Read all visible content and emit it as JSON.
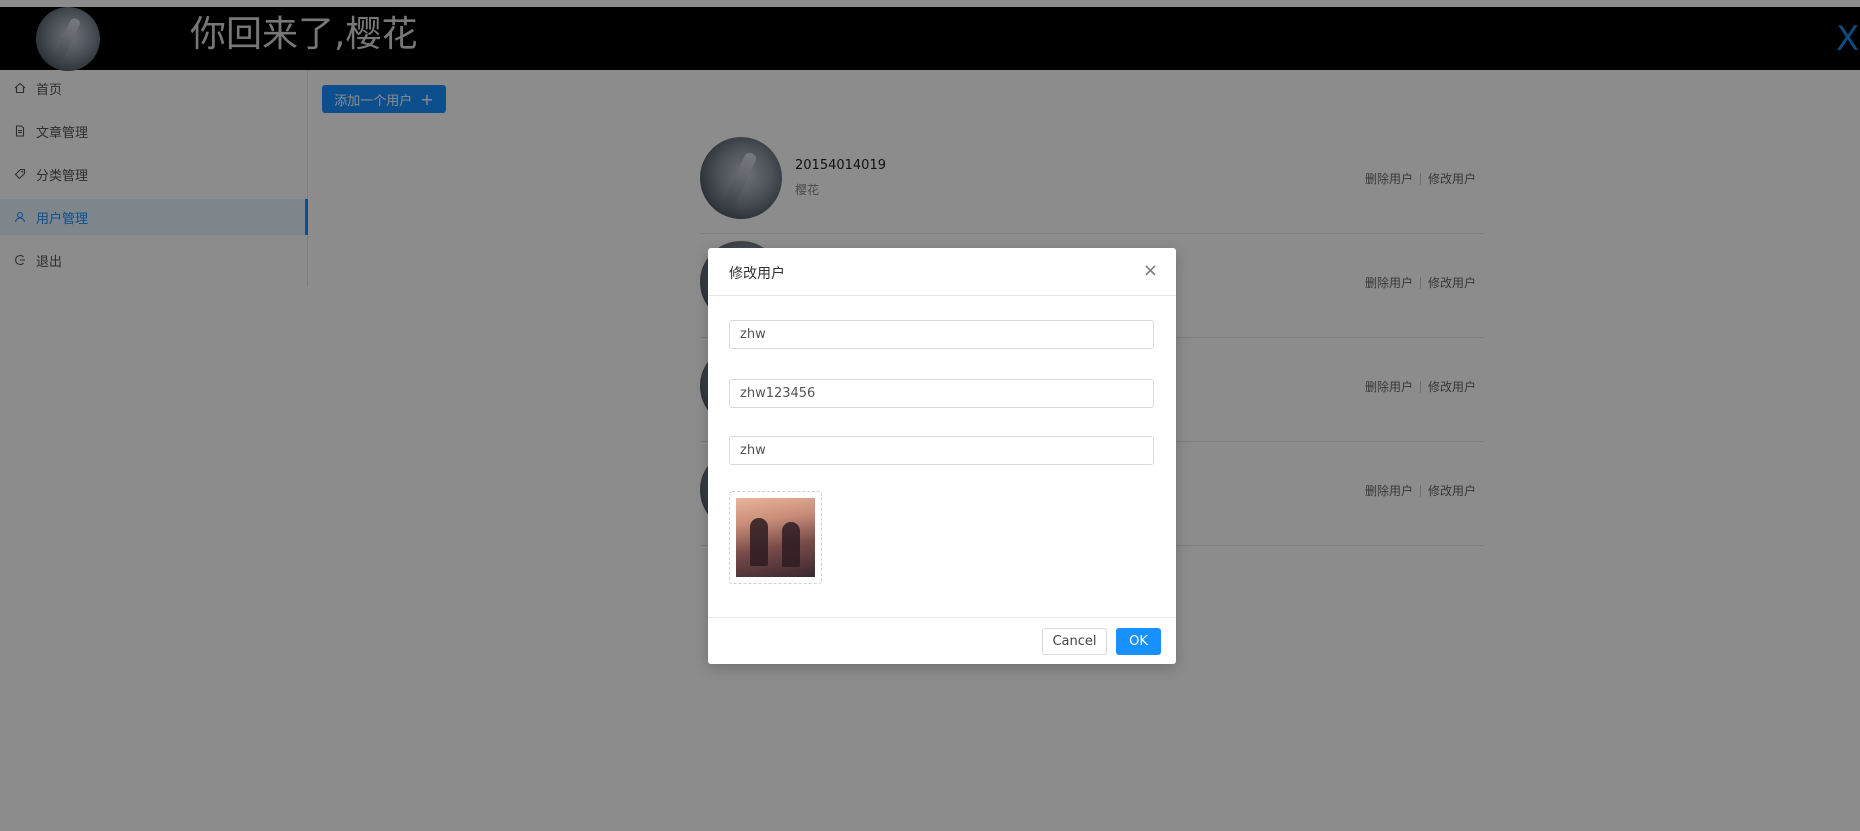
{
  "header": {
    "title": "你回来了,樱花",
    "close_glyph": "X"
  },
  "sidebar": {
    "items": [
      {
        "label": "首页",
        "icon": "home-icon"
      },
      {
        "label": "文章管理",
        "icon": "file-icon"
      },
      {
        "label": "分类管理",
        "icon": "tag-icon"
      },
      {
        "label": "用户管理",
        "icon": "user-icon",
        "active": true
      },
      {
        "label": "退出",
        "icon": "logout-icon"
      }
    ]
  },
  "toolbar": {
    "add_user_label": "添加一个用户",
    "add_user_plus": "+"
  },
  "users": [
    {
      "account": "20154014019",
      "nickname": "樱花",
      "delete_label": "删除用户",
      "edit_label": "修改用户"
    },
    {
      "account": "",
      "nickname": "",
      "delete_label": "删除用户",
      "edit_label": "修改用户"
    },
    {
      "account": "",
      "nickname": "",
      "delete_label": "删除用户",
      "edit_label": "修改用户"
    },
    {
      "account": "",
      "nickname": "",
      "delete_label": "删除用户",
      "edit_label": "修改用户"
    }
  ],
  "modal": {
    "title": "修改用户",
    "close_glyph": "×",
    "fields": {
      "account": "zhw",
      "password": "zhw123456",
      "nickname": "zhw"
    },
    "cancel_label": "Cancel",
    "ok_label": "OK"
  },
  "colors": {
    "primary": "#1890ff",
    "header_bg": "#010101",
    "overlay": "rgba(0,0,0,0.45)"
  }
}
